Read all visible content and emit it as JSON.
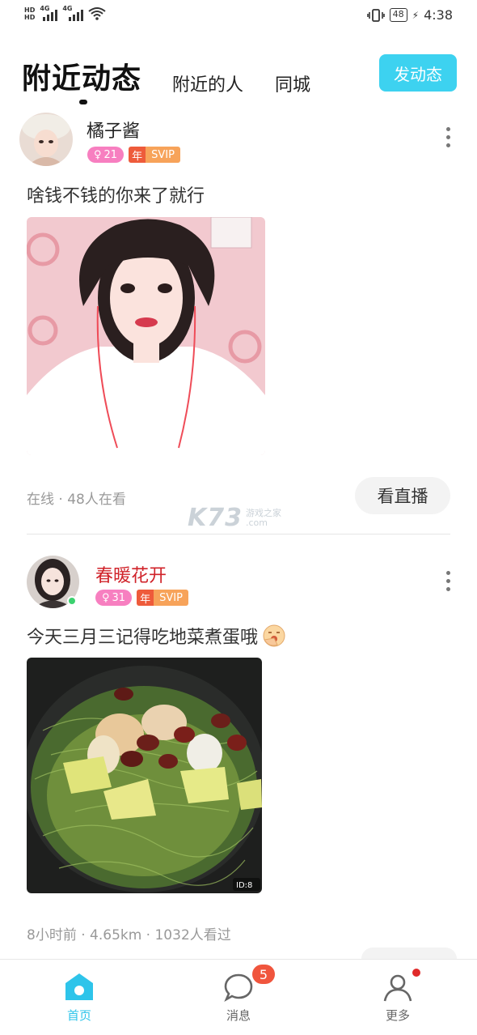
{
  "status_bar": {
    "hd_top": "HD",
    "hd_bottom": "HD",
    "net1": "4G",
    "net2": "4G",
    "battery": "48",
    "time": "4:38"
  },
  "header": {
    "tab_active": "附近动态",
    "tab_people": "附近的人",
    "tab_city": "同城",
    "post_button": "发动态"
  },
  "posts": [
    {
      "username": "橘子酱",
      "level": "21",
      "year_badge": "年",
      "vip_badge": "SVIP",
      "text": "啥钱不钱的你来了就行",
      "meta": "在线 · 48人在看",
      "action": "看直播"
    },
    {
      "username": "春暖花开",
      "level": "31",
      "year_badge": "年",
      "vip_badge": "SVIP",
      "text": "今天三月三记得吃地菜煮蛋哦",
      "meta": "8小时前 · 4.65km · 1032人看过",
      "photo_tag": "ID:8"
    }
  ],
  "watermark": {
    "logo": "K73",
    "line1": "游戏之家",
    "line2": ".com"
  },
  "bottom_nav": {
    "home": "首页",
    "messages": "消息",
    "messages_badge": "5",
    "more": "更多"
  },
  "colors": {
    "accent": "#3dd2f0",
    "active_nav": "#2ec4ea",
    "level_badge": "#f77fc0",
    "vip_year": "#ee5b3b",
    "vip": "#f7a35a",
    "name_red": "#d0232a",
    "notify": "#f0553d"
  }
}
